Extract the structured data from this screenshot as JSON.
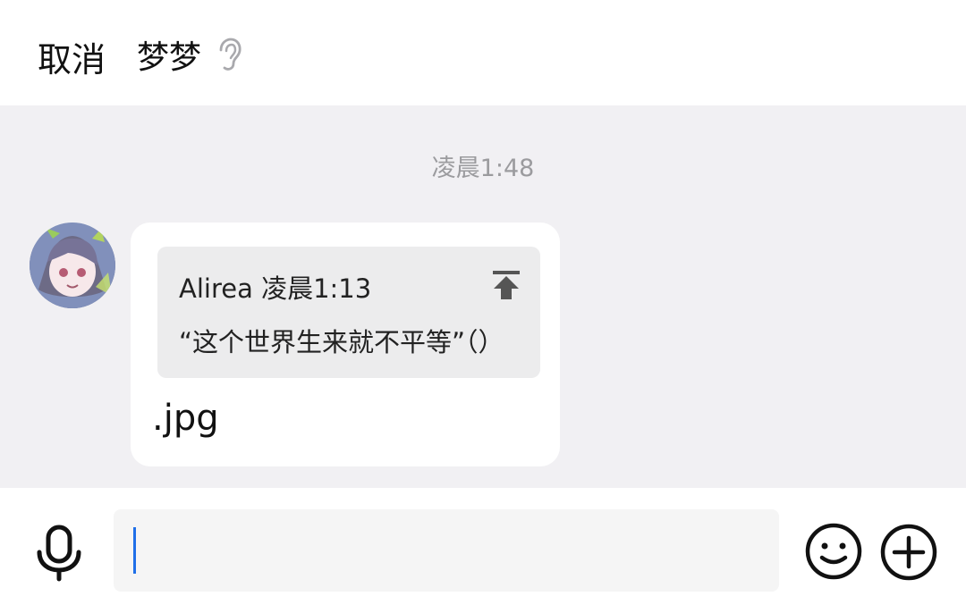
{
  "header": {
    "cancel_label": "取消",
    "title": "梦梦"
  },
  "chat": {
    "timestamp": "凌晨1:48",
    "message": {
      "quote": {
        "meta": "Alirea 凌晨1:13",
        "text": "“这个世界生来就不平等”（）"
      },
      "text": ".jpg"
    }
  },
  "icons": {
    "title": "ear-icon",
    "quote_action": "jump-to-top-icon",
    "voice": "mic-icon",
    "emoji": "emoji-icon",
    "more": "plus-icon"
  }
}
